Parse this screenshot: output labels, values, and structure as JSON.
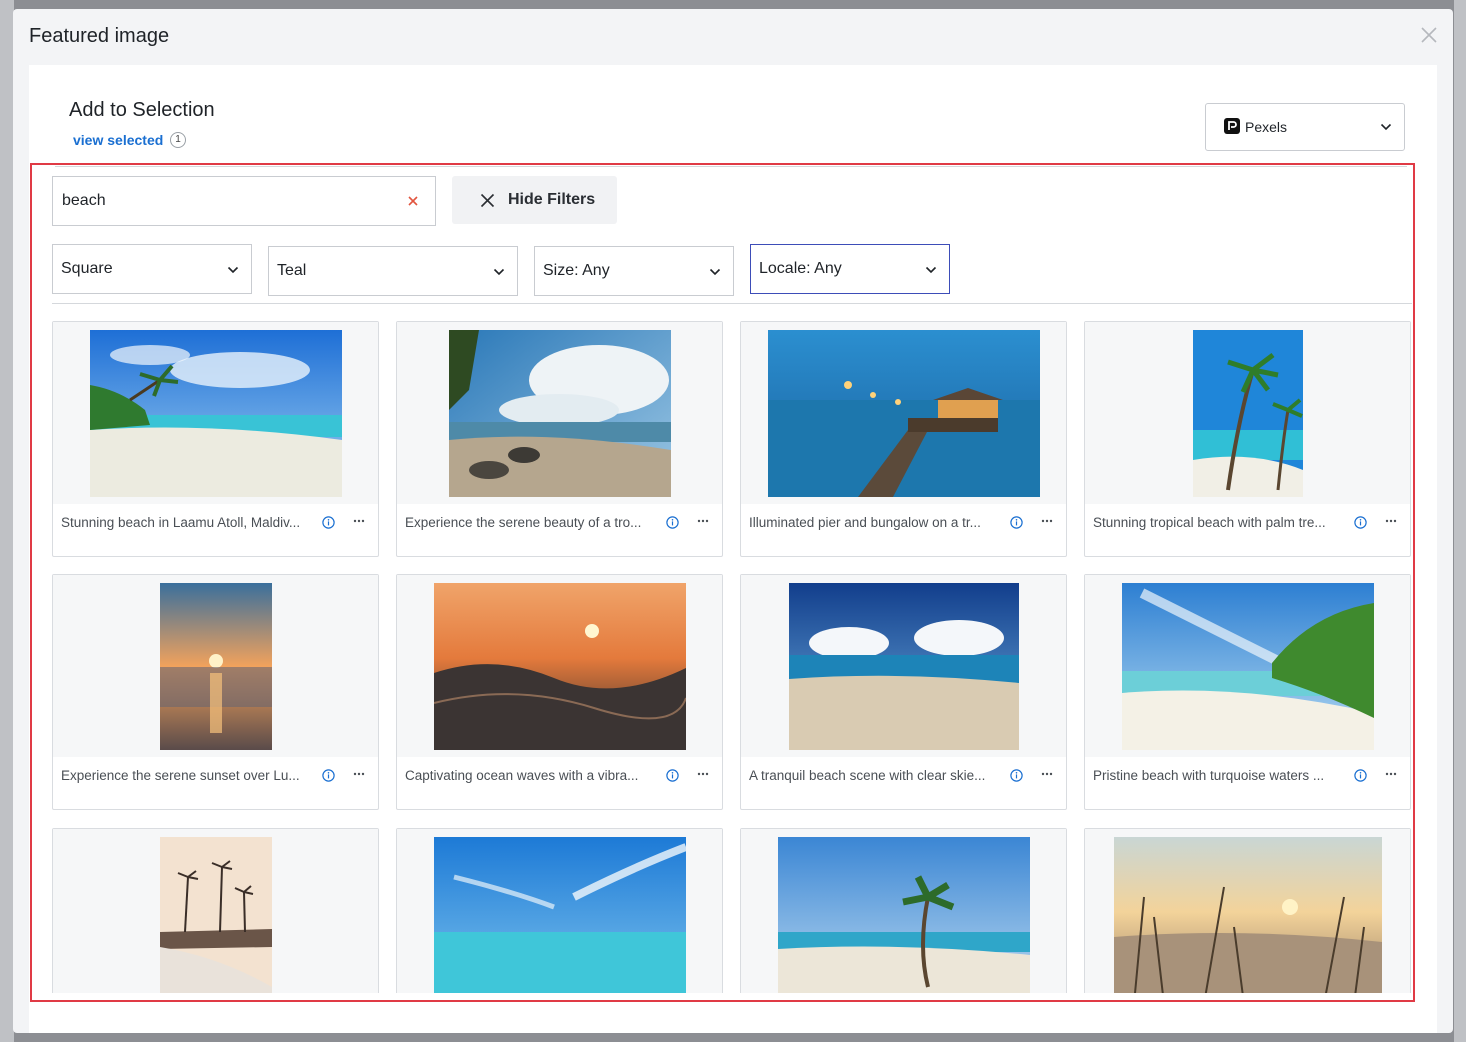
{
  "modal": {
    "title": "Featured image",
    "add_title": "Add to Selection",
    "view_selected_label": "view selected",
    "selected_count": "1",
    "source": "Pexels"
  },
  "search": {
    "value": "beach",
    "hide_filters_label": "Hide Filters"
  },
  "filters": [
    {
      "label": "Square"
    },
    {
      "label": "Teal"
    },
    {
      "label": "Size: Any"
    },
    {
      "label": "Locale: Any"
    }
  ],
  "results": [
    {
      "caption": "Stunning beach in Laamu Atoll, Maldiv..."
    },
    {
      "caption": "Experience the serene beauty of a tro..."
    },
    {
      "caption": "Illuminated pier and bungalow on a tr..."
    },
    {
      "caption": "Stunning tropical beach with palm tre..."
    },
    {
      "caption": "Experience the serene sunset over Lu..."
    },
    {
      "caption": "Captivating ocean waves with a vibra..."
    },
    {
      "caption": "A tranquil beach scene with clear skie..."
    },
    {
      "caption": "Pristine beach with turquoise waters ..."
    },
    {
      "caption": ""
    },
    {
      "caption": ""
    },
    {
      "caption": ""
    },
    {
      "caption": ""
    }
  ],
  "colors": {
    "accent": "#1a6fd1",
    "highlight": "#e03a45",
    "active_filter_border": "#3d4db8"
  }
}
